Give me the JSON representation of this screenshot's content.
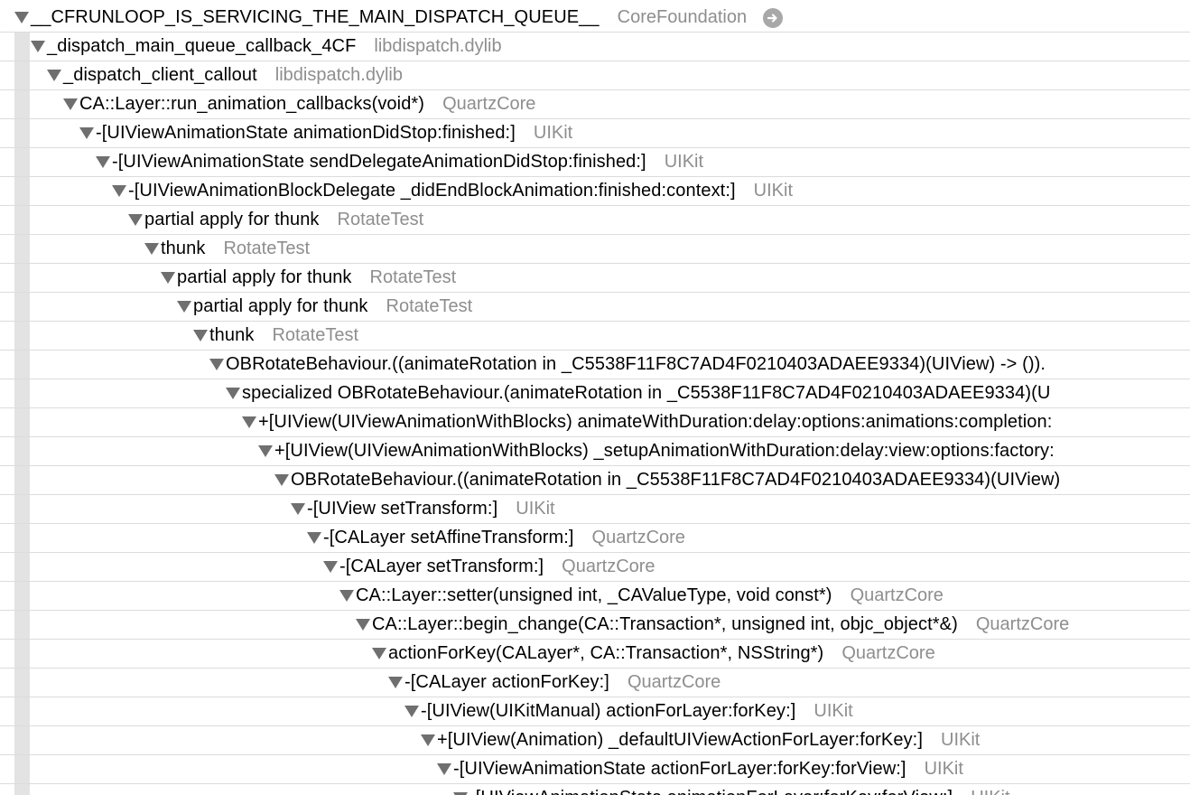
{
  "call_tree": {
    "rows": [
      {
        "symbol": "__CFRUNLOOP_IS_SERVICING_THE_MAIN_DISPATCH_QUEUE__",
        "library": "CoreFoundation",
        "go_to": "arrow-right-circle-icon"
      },
      {
        "symbol": "_dispatch_main_queue_callback_4CF",
        "library": "libdispatch.dylib"
      },
      {
        "symbol": "_dispatch_client_callout",
        "library": "libdispatch.dylib"
      },
      {
        "symbol": "CA::Layer::run_animation_callbacks(void*)",
        "library": "QuartzCore"
      },
      {
        "symbol": "-[UIViewAnimationState animationDidStop:finished:]",
        "library": "UIKit"
      },
      {
        "symbol": "-[UIViewAnimationState sendDelegateAnimationDidStop:finished:]",
        "library": "UIKit"
      },
      {
        "symbol": "-[UIViewAnimationBlockDelegate _didEndBlockAnimation:finished:context:]",
        "library": "UIKit"
      },
      {
        "symbol": "partial apply for thunk",
        "library": "RotateTest"
      },
      {
        "symbol": "thunk",
        "library": "RotateTest"
      },
      {
        "symbol": "partial apply for thunk",
        "library": "RotateTest"
      },
      {
        "symbol": "partial apply for thunk",
        "library": "RotateTest"
      },
      {
        "symbol": "thunk",
        "library": "RotateTest"
      },
      {
        "symbol": "OBRotateBehaviour.((animateRotation in _C5538F11F8C7AD4F0210403ADAEE9334)(UIView) -> ()).",
        "library": ""
      },
      {
        "symbol": "specialized OBRotateBehaviour.(animateRotation in _C5538F11F8C7AD4F0210403ADAEE9334)(U",
        "library": ""
      },
      {
        "symbol": "+[UIView(UIViewAnimationWithBlocks) animateWithDuration:delay:options:animations:completion:",
        "library": ""
      },
      {
        "symbol": "+[UIView(UIViewAnimationWithBlocks) _setupAnimationWithDuration:delay:view:options:factory:",
        "library": ""
      },
      {
        "symbol": "OBRotateBehaviour.((animateRotation in _C5538F11F8C7AD4F0210403ADAEE9334)(UIView)",
        "library": ""
      },
      {
        "symbol": "-[UIView setTransform:]",
        "library": "UIKit"
      },
      {
        "symbol": "-[CALayer setAffineTransform:]",
        "library": "QuartzCore"
      },
      {
        "symbol": "-[CALayer setTransform:]",
        "library": "QuartzCore"
      },
      {
        "symbol": "CA::Layer::setter(unsigned int, _CAValueType, void const*)",
        "library": "QuartzCore"
      },
      {
        "symbol": "CA::Layer::begin_change(CA::Transaction*, unsigned int, objc_object*&)",
        "library": "QuartzCore"
      },
      {
        "symbol": "actionForKey(CALayer*, CA::Transaction*, NSString*)",
        "library": "QuartzCore"
      },
      {
        "symbol": "-[CALayer actionForKey:]",
        "library": "QuartzCore"
      },
      {
        "symbol": "-[UIView(UIKitManual) actionForLayer:forKey:]",
        "library": "UIKit"
      },
      {
        "symbol": "+[UIView(Animation) _defaultUIViewActionForLayer:forKey:]",
        "library": "UIKit"
      },
      {
        "symbol": "-[UIViewAnimationState actionForLayer:forKey:forView:]",
        "library": "UIKit"
      },
      {
        "symbol": "-[UIViewAnimationState animationForLayer:forKey:forView:]",
        "library": "UIKit"
      }
    ]
  },
  "colors": {
    "symbol_text": "#000000",
    "library_text": "#8e8e8e",
    "disclosure_triangle": "#6f6f6f",
    "row_separator": "#dcdcdc",
    "indent_guide": "#e3e3e3",
    "goto_button": "#a8a8a8"
  }
}
